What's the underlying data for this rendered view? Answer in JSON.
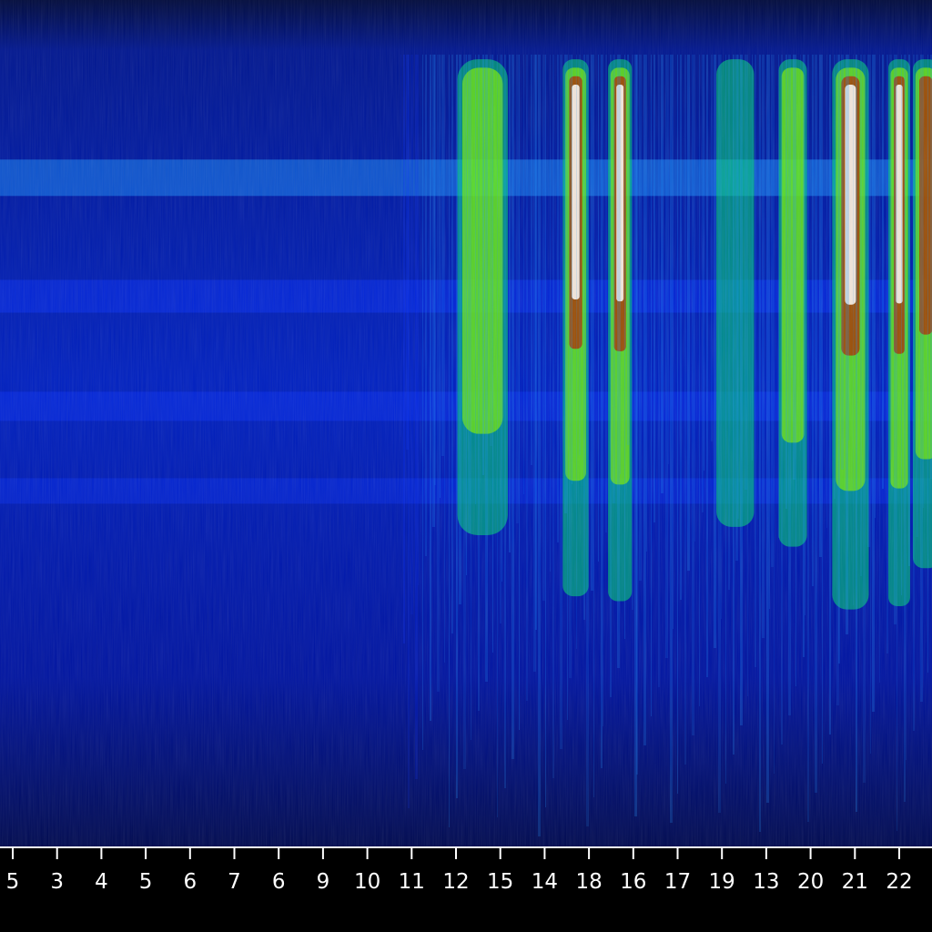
{
  "chart_data": {
    "type": "heatmap",
    "x_tick_labels": [
      "5",
      "3",
      "4",
      "5",
      "6",
      "7",
      "6",
      "9",
      "10",
      "11",
      "12",
      "15",
      "14",
      "18",
      "16",
      "17",
      "19",
      "13",
      "20",
      "21",
      "22"
    ],
    "colorscale": [
      "#000a3c",
      "#0010a8",
      "#0a34ff",
      "#1e96ff",
      "#00e070",
      "#7cf000",
      "#ffd000",
      "#b02400",
      "#ffffff"
    ],
    "horizontal_bands": [
      {
        "y": 0.21,
        "strength": 0.55
      },
      {
        "y": 0.35,
        "strength": 0.45
      },
      {
        "y": 0.48,
        "strength": 0.35
      },
      {
        "y": 0.58,
        "strength": 0.25
      }
    ],
    "activity_regions": [
      {
        "x": 10.6,
        "w": 1.3,
        "level": 0.55
      },
      {
        "x": 12.7,
        "w": 0.55,
        "level": 0.92
      },
      {
        "x": 13.7,
        "w": 0.5,
        "level": 0.95
      },
      {
        "x": 16.3,
        "w": 1.0,
        "level": 0.5
      },
      {
        "x": 17.6,
        "w": 0.7,
        "level": 0.62
      },
      {
        "x": 18.9,
        "w": 0.75,
        "level": 1.0
      },
      {
        "x": 20.0,
        "w": 0.45,
        "level": 0.98
      },
      {
        "x": 20.6,
        "w": 0.6,
        "level": 0.75
      }
    ],
    "grid": false
  }
}
